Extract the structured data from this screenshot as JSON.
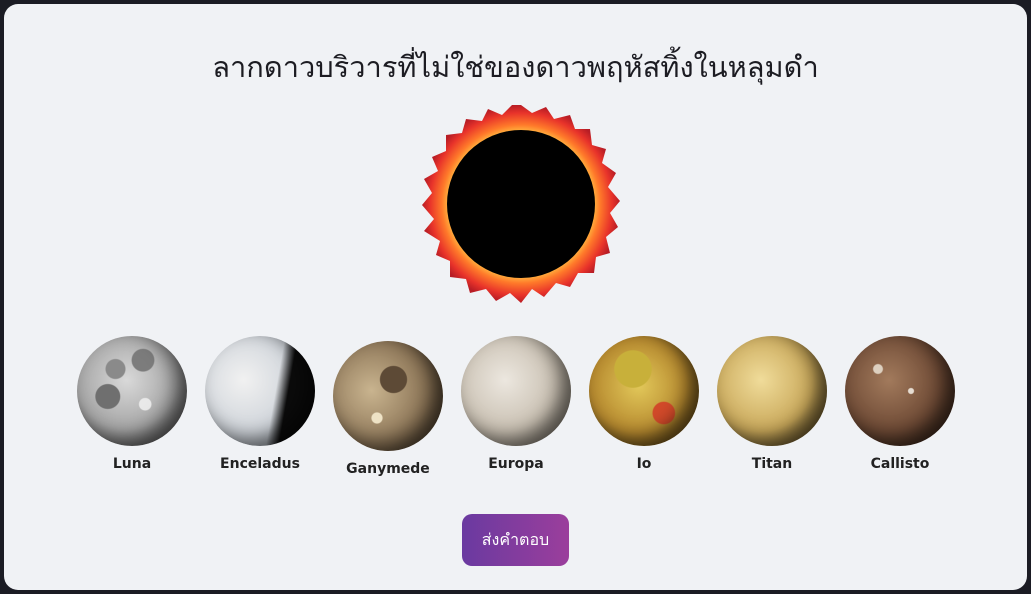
{
  "title": "ลากดาวบริวารที่ไม่ใช่ของดาวพฤหัสทิ้งในหลุมดำ",
  "black_hole": {
    "icon": "black-hole-icon"
  },
  "moons": [
    {
      "name": "Luna"
    },
    {
      "name": "Enceladus"
    },
    {
      "name": "Ganymede"
    },
    {
      "name": "Europa"
    },
    {
      "name": "Io"
    },
    {
      "name": "Titan"
    },
    {
      "name": "Callisto"
    }
  ],
  "submit_label": "ส่งคำตอบ",
  "colors": {
    "accent_start": "#6a3aa0",
    "accent_end": "#9b3e9c",
    "background": "#f0f2f5"
  }
}
